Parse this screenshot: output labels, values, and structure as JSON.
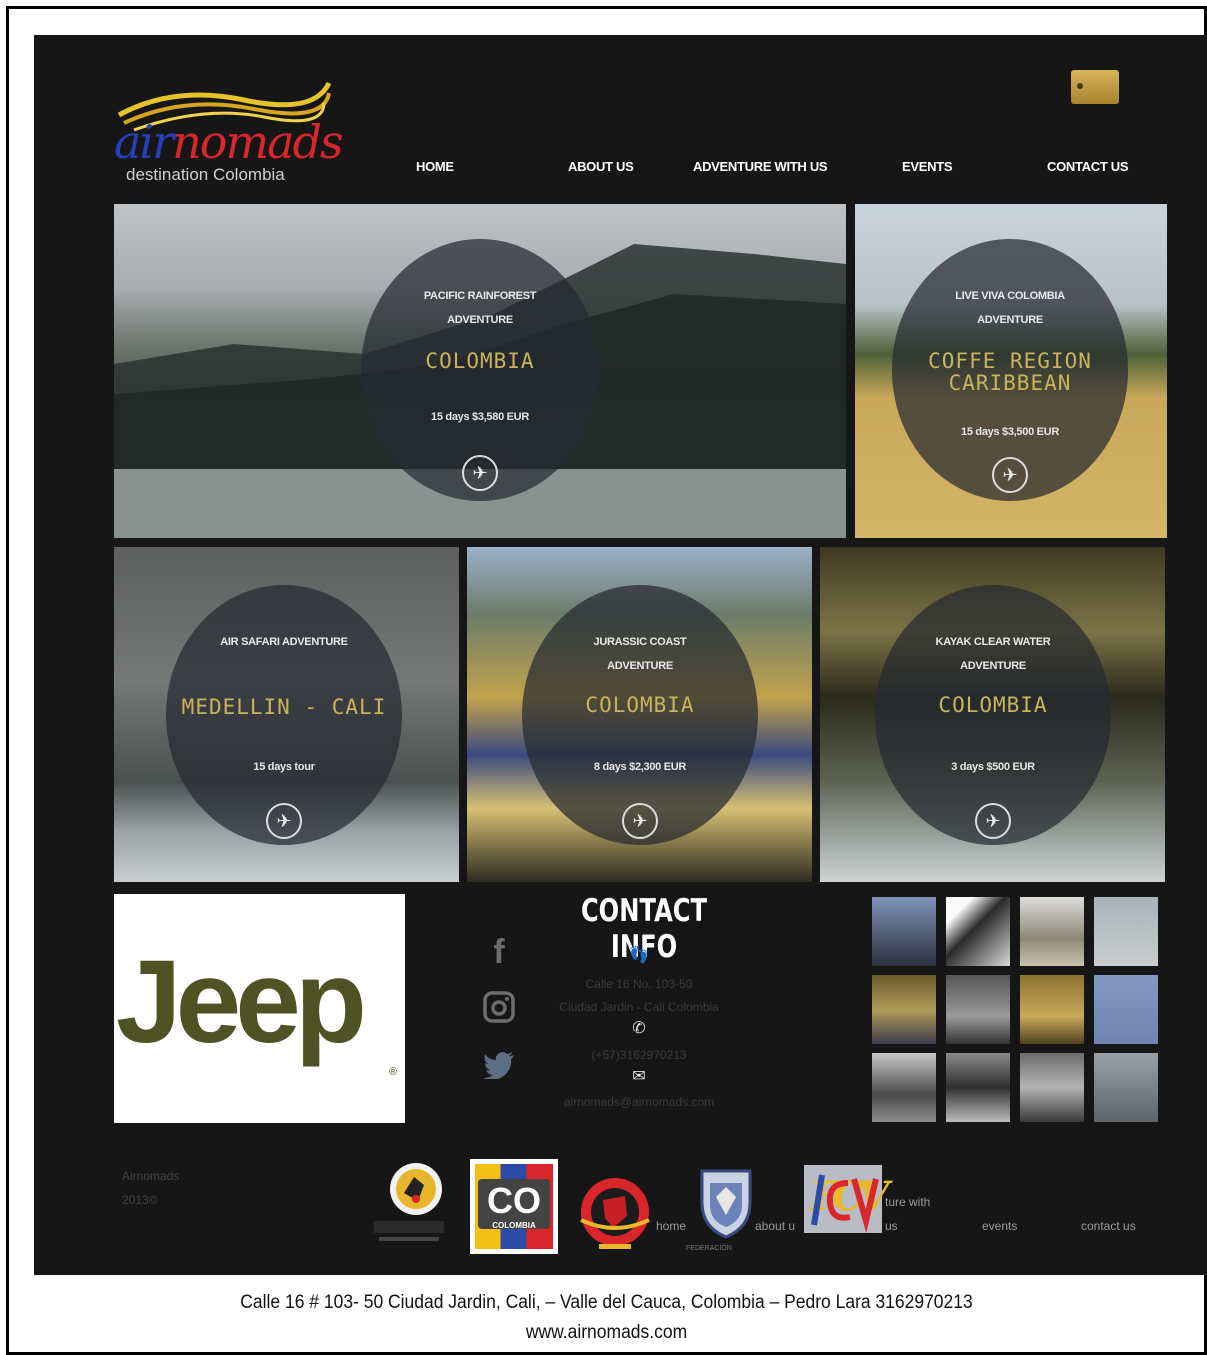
{
  "header": {
    "logo_part1": "air",
    "logo_part2": "nomads",
    "tagline": "destination Colombia"
  },
  "nav": {
    "items": [
      "HOME",
      "ABOUT US",
      "ADVENTURE WITH US",
      "EVENTS",
      "CONTACT US"
    ]
  },
  "tours": [
    {
      "subtitle_1": "PACIFIC RAINFOREST",
      "subtitle_2": "ADVENTURE",
      "destination_1": "COLOMBIA",
      "destination_2": "",
      "price": "15 days $3,580 EUR",
      "icon": "bird-icon"
    },
    {
      "subtitle_1": "LIVE VIVA COLOMBIA",
      "subtitle_2": "ADVENTURE",
      "destination_1": "COFFE REGION",
      "destination_2": "CARIBBEAN",
      "price": "15 days $3,500 EUR",
      "icon": "bird-icon"
    },
    {
      "subtitle_1": "AIR SAFARI ADVENTURE",
      "subtitle_2": "",
      "destination_1": "MEDELLIN - CALI",
      "destination_2": "",
      "price": "15 days tour",
      "icon": "bird-icon"
    },
    {
      "subtitle_1": "JURASSIC COAST",
      "subtitle_2": "ADVENTURE",
      "destination_1": "COLOMBIA",
      "destination_2": "",
      "price": "8 days $2,300 EUR",
      "icon": "bird-icon"
    },
    {
      "subtitle_1": "KAYAK CLEAR WATER",
      "subtitle_2": "ADVENTURE",
      "destination_1": "COLOMBIA",
      "destination_2": "",
      "price": "3 days $500 EUR",
      "icon": "bird-icon"
    }
  ],
  "sponsor": {
    "name": "Jeep",
    "reg": "®"
  },
  "contact": {
    "title": "CONTACT INFO",
    "address_1": "Calle 16 No. 103-50",
    "address_2": "Ciudad Jardin - Cali Colombia",
    "phone": "(+57)3162970213",
    "email": "airnomads@airnomads.com",
    "social": [
      "facebook-icon",
      "instagram-icon",
      "twitter-icon"
    ]
  },
  "footer": {
    "copyright_1": "Airnomads",
    "copyright_2": "2013©",
    "links": [
      "home",
      "about u",
      "ture with",
      "us",
      "events",
      "contact us"
    ],
    "partner_co": "CO",
    "partner_co_sub": "COLOMBIA",
    "partner_fcv": "FCV",
    "partner_fed": "FEDERACIÓN"
  },
  "caption": {
    "line_1": "Calle 16 # 103- 50 Ciudad Jardin, Cali, – Valle del Cauca, Colombia – Pedro Lara 3162970213",
    "line_2": "www.airnomads.com"
  },
  "colors": {
    "background": "#161616",
    "accent_gold": "#c9b35b",
    "jeep_olive": "#4f5324"
  }
}
